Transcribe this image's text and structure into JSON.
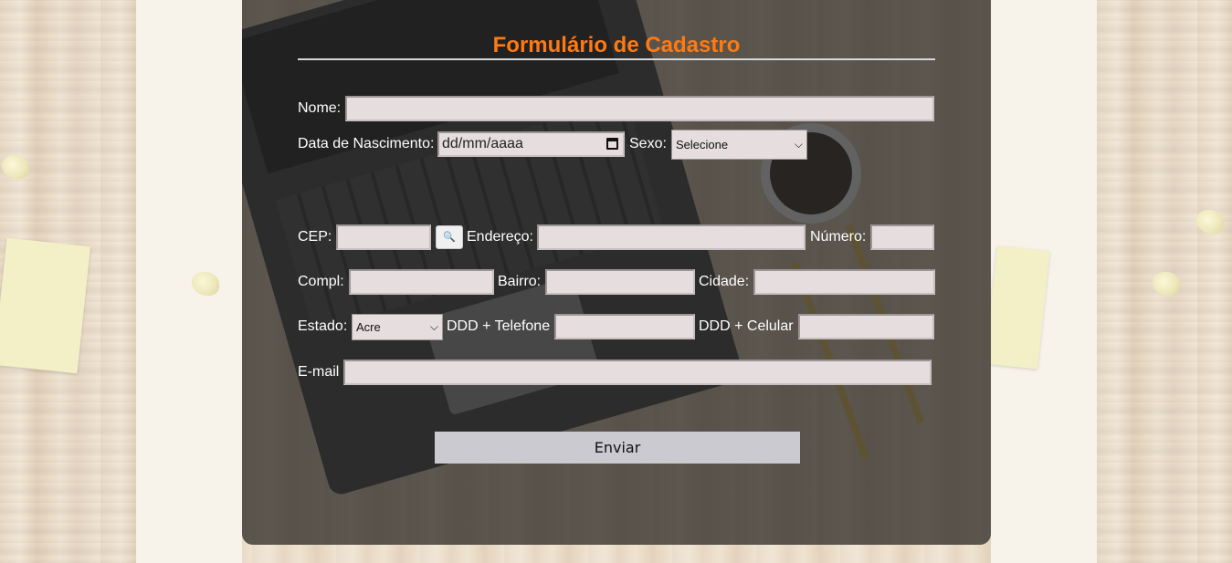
{
  "form": {
    "title": "Formulário de Cadastro",
    "fields": {
      "nome": {
        "label": "Nome:",
        "value": ""
      },
      "data_nascimento": {
        "label": "Data de Nascimento:",
        "placeholder": "dd/mm/aaaa"
      },
      "sexo": {
        "label": "Sexo:",
        "selected": "Selecione"
      },
      "cep": {
        "label": "CEP:",
        "value": ""
      },
      "endereco": {
        "label": "Endereço:",
        "value": ""
      },
      "numero": {
        "label": "Número:",
        "value": ""
      },
      "compl": {
        "label": "Compl:",
        "value": ""
      },
      "bairro": {
        "label": "Bairro:",
        "value": ""
      },
      "cidade": {
        "label": "Cidade:",
        "value": ""
      },
      "estado": {
        "label": "Estado:",
        "selected": "Acre"
      },
      "telefone": {
        "label": "DDD + Telefone",
        "value": ""
      },
      "celular": {
        "label": "DDD + Celular",
        "value": ""
      },
      "email": {
        "label": "E-mail",
        "value": ""
      }
    },
    "search_icon": "magnifier-icon",
    "submit_label": "Enviar"
  },
  "colors": {
    "title": "#ff7a12",
    "input_bg": "#e6dede",
    "submit_bg": "#cacad0",
    "overlay": "rgba(45,45,45,0.72)"
  }
}
